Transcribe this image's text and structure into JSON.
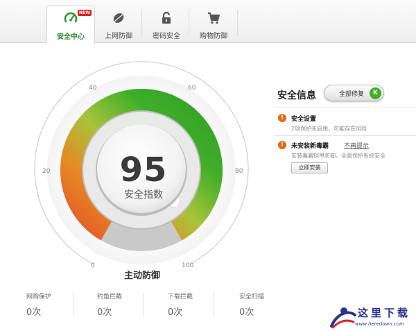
{
  "tabs": [
    {
      "label": "安全中心",
      "icon": "speedometer-icon",
      "active": true,
      "badge": "NEW"
    },
    {
      "label": "上网防御",
      "icon": "shield-leaf-icon"
    },
    {
      "label": "密码安全",
      "icon": "lock-icon"
    },
    {
      "label": "购物防御",
      "icon": "shopping-cart-icon"
    }
  ],
  "gauge": {
    "score": "95",
    "score_label": "安全指数",
    "defense_label": "主动防御",
    "ticks": [
      "0",
      "20",
      "40",
      "60",
      "80",
      "100"
    ],
    "value_fraction": 0.95
  },
  "stats": [
    {
      "name": "网购保护",
      "count": "0次"
    },
    {
      "name": "钓鱼拦截",
      "count": "0次"
    },
    {
      "name": "下载拦截",
      "count": "0次"
    },
    {
      "name": "安全扫描",
      "count": "0次"
    }
  ],
  "info": {
    "title": "安全信息",
    "repair_label": "全部修复",
    "repair_key": "K",
    "items": [
      {
        "title": "安全设置",
        "desc": "2项保护未启用，可能存在风险"
      },
      {
        "title": "未安装新毒霸",
        "link": "不再提示",
        "desc": "安装毒霸铠甲防御，全面保护系统安全",
        "button": "立即安装"
      }
    ]
  },
  "watermark": {
    "text": "这里下载",
    "url": "www.heredown.com"
  },
  "colors": {
    "accent_green": "#3fae29",
    "warning_orange": "#e36a12",
    "gauge_red": "#e8442a"
  }
}
